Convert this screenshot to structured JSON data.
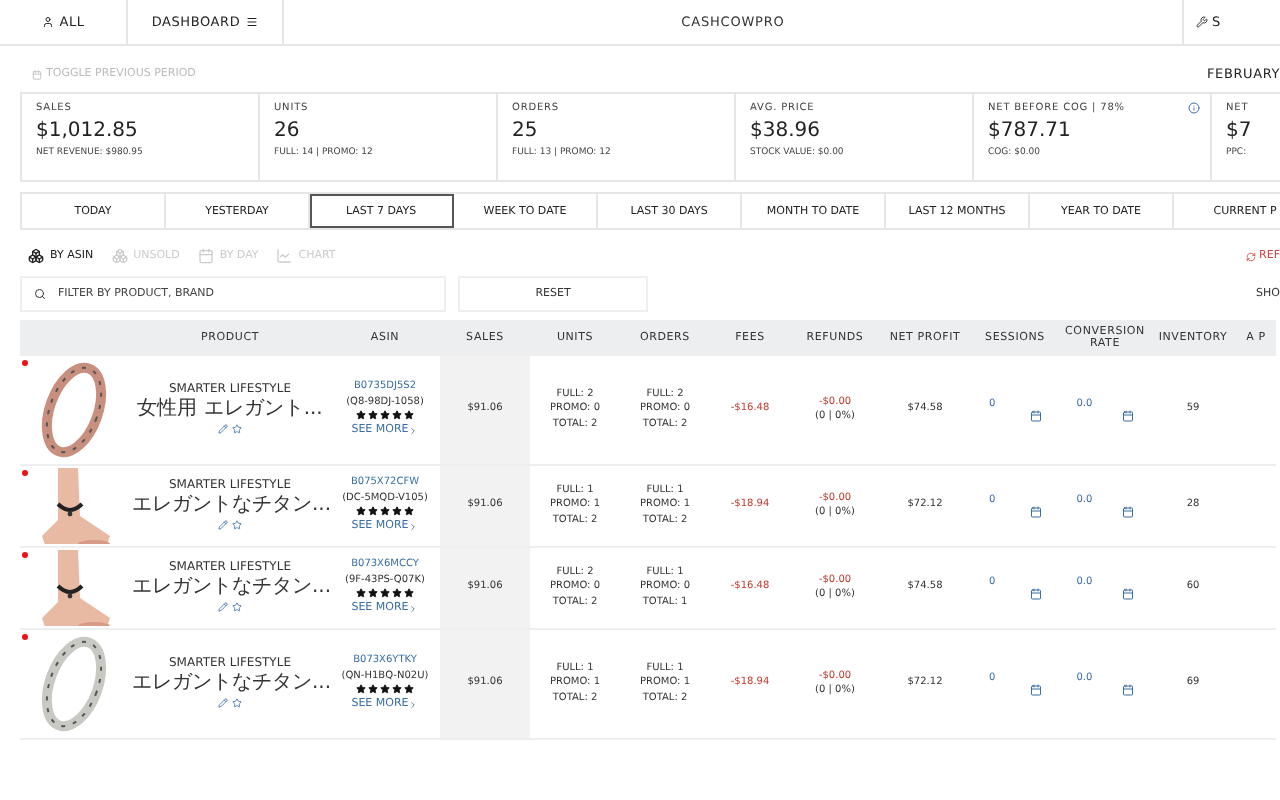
{
  "nav": {
    "all": "ALL",
    "dashboard": "DASHBOARD",
    "title": "CASHCOWPRO",
    "right": "S"
  },
  "toggle": "TOGGLE PREVIOUS PERIOD",
  "period_label": "FEBRUARY",
  "stats": [
    {
      "label": "SALES",
      "value": "$1,012.85",
      "sub": "NET REVENUE: $980.95",
      "info": false
    },
    {
      "label": "UNITS",
      "value": "26",
      "sub": "FULL: 14 | PROMO: 12",
      "info": false
    },
    {
      "label": "ORDERS",
      "value": "25",
      "sub": "FULL: 13 | PROMO: 12",
      "info": false
    },
    {
      "label": "AVG. PRICE",
      "value": "$38.96",
      "sub": "STOCK VALUE: $0.00",
      "info": false
    },
    {
      "label": "NET BEFORE COG | 78%",
      "value": "$787.71",
      "sub": "COG: $0.00",
      "info": true
    },
    {
      "label": "NET",
      "value": "$7",
      "sub": "PPC:"
    }
  ],
  "periods": [
    {
      "label": "TODAY",
      "selected": false
    },
    {
      "label": "YESTERDAY",
      "selected": false
    },
    {
      "label": "LAST 7 DAYS",
      "selected": true
    },
    {
      "label": "WEEK TO DATE",
      "selected": false
    },
    {
      "label": "LAST 30 DAYS",
      "selected": false
    },
    {
      "label": "MONTH TO DATE",
      "selected": false
    },
    {
      "label": "LAST 12 MONTHS",
      "selected": false
    },
    {
      "label": "YEAR TO DATE",
      "selected": false
    },
    {
      "label": "CURRENT P",
      "selected": false
    }
  ],
  "views": [
    {
      "kind": "asin",
      "label": "BY ASIN",
      "selected": true
    },
    {
      "kind": "unsold",
      "label": "UNSOLD",
      "selected": false
    },
    {
      "kind": "day",
      "label": "BY DAY",
      "selected": false
    },
    {
      "kind": "chart",
      "label": "CHART",
      "selected": false
    }
  ],
  "refresh": "REF",
  "filter": {
    "placeholder": "FILTER BY PRODUCT, BRAND"
  },
  "reset": "RESET",
  "show": "SHO",
  "table": {
    "columns": [
      "",
      "PRODUCT",
      "ASIN",
      "SALES",
      "UNITS",
      "ORDERS",
      "FEES",
      "REFUNDS",
      "NET PROFIT",
      "SESSIONS",
      "CONVERSION RATE",
      "INVENTORY",
      "A P"
    ],
    "rows": [
      {
        "product": "SMARTER LIFESTYLE 女性用 エレガント...",
        "asin": "B0735DJ5S2",
        "sku": "(Q8-98DJ-1058)",
        "stars": 5,
        "see_more": "SEE MORE",
        "sales": "$91.06",
        "units": [
          "FULL: 2",
          "PROMO: 0",
          "TOTAL: 2"
        ],
        "orders": [
          "FULL: 2",
          "PROMO: 0",
          "TOTAL: 2"
        ],
        "fees": "-$16.48",
        "refunds": "-$0.00",
        "refunds_note": "(0 | 0%)",
        "net_profit": "$74.58",
        "sessions": "0",
        "conversion": "0.0",
        "inventory": "59"
      },
      {
        "product": "SMARTER LIFESTYLE エレガントなチタン...",
        "asin": "B075X72CFW",
        "sku": "(DC-5MQD-V105)",
        "stars": 5,
        "see_more": "SEE MORE",
        "sales": "$91.06",
        "units": [
          "FULL: 1",
          "PROMO: 1",
          "TOTAL: 2"
        ],
        "orders": [
          "FULL: 1",
          "PROMO: 1",
          "TOTAL: 2"
        ],
        "fees": "-$18.94",
        "refunds": "-$0.00",
        "refunds_note": "(0 | 0%)",
        "net_profit": "$72.12",
        "sessions": "0",
        "conversion": "0.0",
        "inventory": "28"
      },
      {
        "product": "SMARTER LIFESTYLE エレガントなチタン...",
        "asin": "B073X6MCCY",
        "sku": "(9F-43PS-Q07K)",
        "stars": 5,
        "see_more": "SEE MORE",
        "sales": "$91.06",
        "units": [
          "FULL: 2",
          "PROMO: 0",
          "TOTAL: 2"
        ],
        "orders": [
          "FULL: 1",
          "PROMO: 0",
          "TOTAL: 1"
        ],
        "fees": "-$16.48",
        "refunds": "-$0.00",
        "refunds_note": "(0 | 0%)",
        "net_profit": "$74.58",
        "sessions": "0",
        "conversion": "0.0",
        "inventory": "60"
      },
      {
        "product": "SMARTER LIFESTYLE エレガントなチタン...",
        "asin": "B073X6YTKY",
        "sku": "(QN-H1BQ-N02U)",
        "stars": 5,
        "see_more": "SEE MORE",
        "sales": "$91.06",
        "units": [
          "FULL: 1",
          "PROMO: 1",
          "TOTAL: 2"
        ],
        "orders": [
          "FULL: 1",
          "PROMO: 1",
          "TOTAL: 2"
        ],
        "fees": "-$18.94",
        "refunds": "-$0.00",
        "refunds_note": "(0 | 0%)",
        "net_profit": "$72.12",
        "sessions": "0",
        "conversion": "0.0",
        "inventory": "69"
      }
    ]
  }
}
